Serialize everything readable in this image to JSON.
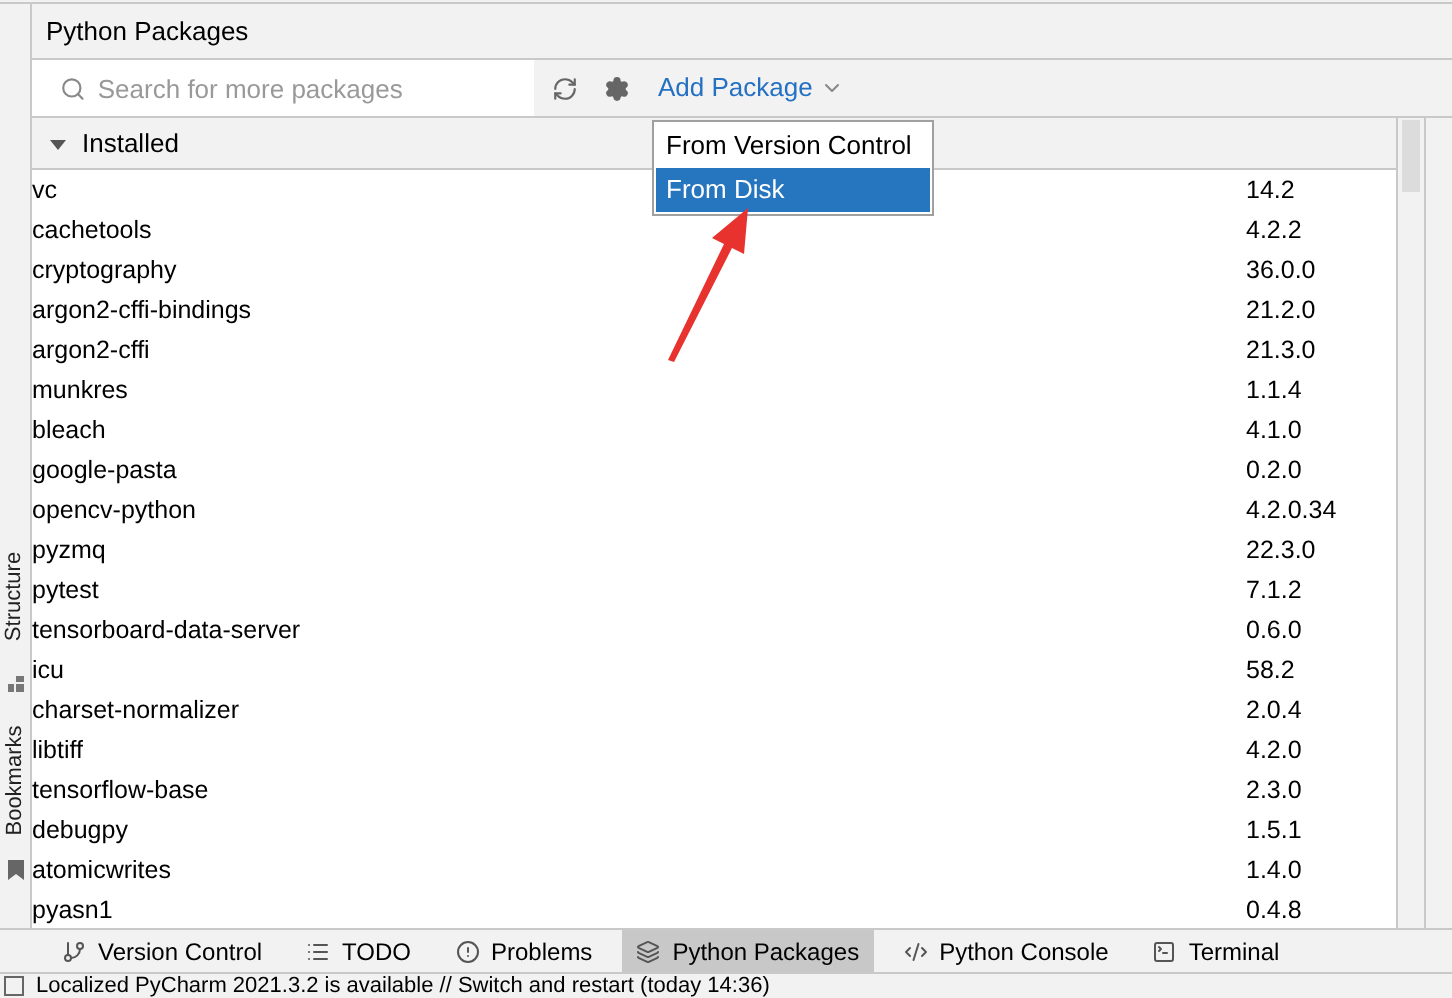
{
  "side_tabs": [
    {
      "label": "Structure",
      "kind": "structure"
    },
    {
      "label": "Bookmarks",
      "kind": "bookmarks"
    }
  ],
  "panel": {
    "title": "Python Packages"
  },
  "toolbar": {
    "search": {
      "placeholder": "Search for more packages"
    },
    "add_package": "Add Package"
  },
  "menu": {
    "items": [
      {
        "label": "From Version Control",
        "selected": false
      },
      {
        "label": "From Disk",
        "selected": true
      }
    ]
  },
  "section": {
    "label": "Installed",
    "expanded": true
  },
  "packages": [
    {
      "name": "vc",
      "version": "14.2"
    },
    {
      "name": "cachetools",
      "version": "4.2.2"
    },
    {
      "name": "cryptography",
      "version": "36.0.0"
    },
    {
      "name": "argon2-cffi-bindings",
      "version": "21.2.0"
    },
    {
      "name": "argon2-cffi",
      "version": "21.3.0"
    },
    {
      "name": "munkres",
      "version": "1.1.4"
    },
    {
      "name": "bleach",
      "version": "4.1.0"
    },
    {
      "name": "google-pasta",
      "version": "0.2.0"
    },
    {
      "name": "opencv-python",
      "version": "4.2.0.34"
    },
    {
      "name": "pyzmq",
      "version": "22.3.0"
    },
    {
      "name": "pytest",
      "version": "7.1.2"
    },
    {
      "name": "tensorboard-data-server",
      "version": "0.6.0"
    },
    {
      "name": "icu",
      "version": "58.2"
    },
    {
      "name": "charset-normalizer",
      "version": "2.0.4"
    },
    {
      "name": "libtiff",
      "version": "4.2.0"
    },
    {
      "name": "tensorflow-base",
      "version": "2.3.0"
    },
    {
      "name": "debugpy",
      "version": "1.5.1"
    },
    {
      "name": "atomicwrites",
      "version": "1.4.0"
    },
    {
      "name": "pyasn1",
      "version": "0.4.8"
    }
  ],
  "tool_tabs": [
    {
      "label": "Version Control",
      "kind": "vcs",
      "selected": false
    },
    {
      "label": "TODO",
      "kind": "todo",
      "selected": false
    },
    {
      "label": "Problems",
      "kind": "problems",
      "selected": false
    },
    {
      "label": "Python Packages",
      "kind": "packages",
      "selected": true
    },
    {
      "label": "Python Console",
      "kind": "console",
      "selected": false
    },
    {
      "label": "Terminal",
      "kind": "terminal",
      "selected": false
    }
  ],
  "status_bar": {
    "message": "Localized PyCharm 2021.3.2 is available // Switch and restart (today 14:36)"
  }
}
